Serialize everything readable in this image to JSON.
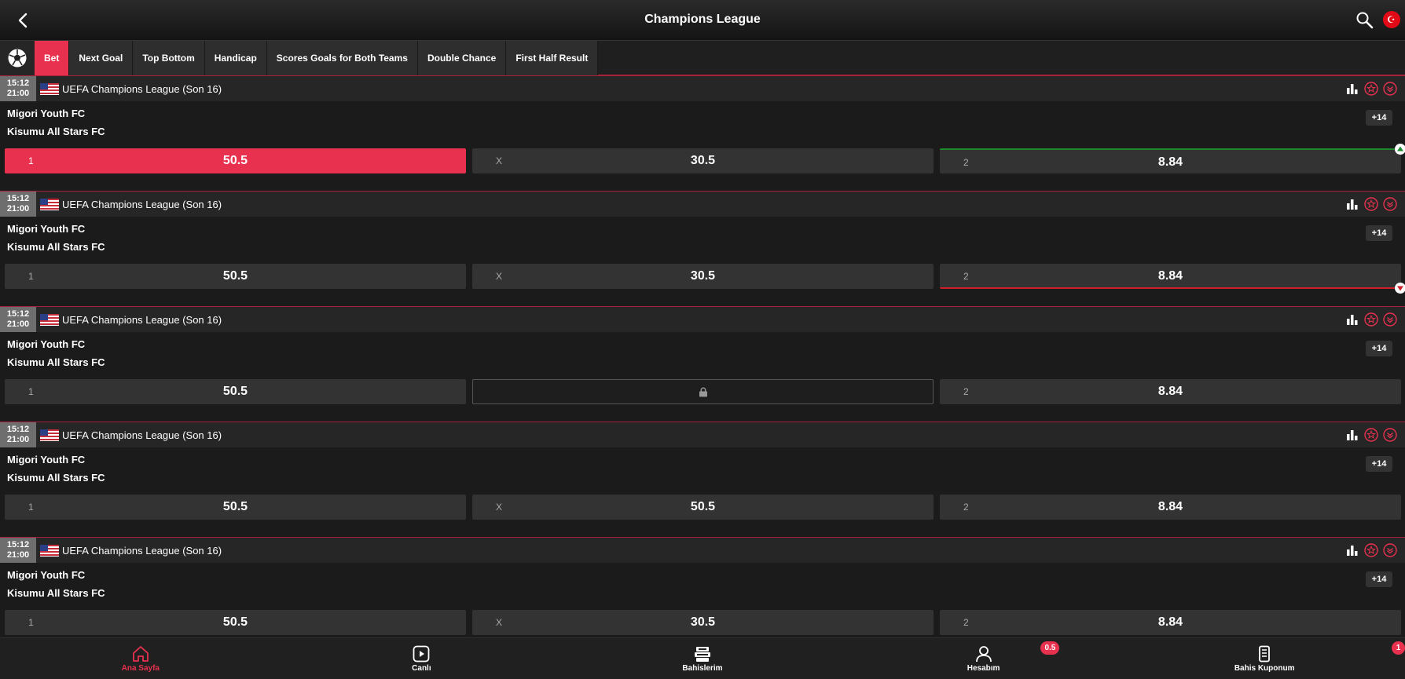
{
  "header": {
    "title": "Champions League"
  },
  "flag_symbol": "☪",
  "tabs": [
    {
      "label": "Bet",
      "active": true
    },
    {
      "label": "Next Goal"
    },
    {
      "label": "Top Bottom"
    },
    {
      "label": "Handicap"
    },
    {
      "label": "Scores Goals for Both Teams"
    },
    {
      "label": "Double Chance"
    },
    {
      "label": "First Half Result"
    }
  ],
  "events": [
    {
      "time": "15:12",
      "hour": "21:00",
      "league": "UEFA Champions League (Son 16)",
      "team1": "Migori Youth FC",
      "team2": "Kisumu All Stars FC",
      "more": "+14",
      "odds": [
        {
          "label": "1",
          "value": "50.5",
          "state": "selected"
        },
        {
          "label": "X",
          "value": "30.5"
        },
        {
          "label": "2",
          "value": "8.84",
          "trend": "up"
        }
      ]
    },
    {
      "time": "15:12",
      "hour": "21:00",
      "league": "UEFA Champions League (Son 16)",
      "team1": "Migori Youth FC",
      "team2": "Kisumu All Stars FC",
      "more": "+14",
      "odds": [
        {
          "label": "1",
          "value": "50.5"
        },
        {
          "label": "X",
          "value": "30.5"
        },
        {
          "label": "2",
          "value": "8.84",
          "trend": "down"
        }
      ]
    },
    {
      "time": "15:12",
      "hour": "21:00",
      "league": "UEFA Champions League (Son 16)",
      "team1": "Migori Youth FC",
      "team2": "Kisumu All Stars FC",
      "more": "+14",
      "odds": [
        {
          "label": "1",
          "value": "50.5"
        },
        {
          "label": "",
          "value": "",
          "state": "locked"
        },
        {
          "label": "2",
          "value": "8.84"
        }
      ]
    },
    {
      "time": "15:12",
      "hour": "21:00",
      "league": "UEFA Champions League (Son 16)",
      "team1": "Migori Youth FC",
      "team2": "Kisumu All Stars FC",
      "more": "+14",
      "odds": [
        {
          "label": "1",
          "value": "50.5"
        },
        {
          "label": "X",
          "value": "50.5"
        },
        {
          "label": "2",
          "value": "8.84"
        }
      ]
    },
    {
      "time": "15:12",
      "hour": "21:00",
      "league": "UEFA Champions League (Son 16)",
      "team1": "Migori Youth FC",
      "team2": "Kisumu All Stars FC",
      "more": "+14",
      "odds": [
        {
          "label": "1",
          "value": "50.5"
        },
        {
          "label": "X",
          "value": "30.5"
        },
        {
          "label": "2",
          "value": "8.84"
        }
      ]
    }
  ],
  "footer": [
    {
      "label": "Ana Sayfa",
      "icon": "home-icon",
      "active": true
    },
    {
      "label": "Canlı",
      "icon": "play-icon"
    },
    {
      "label": "Bahislerim",
      "icon": "bets-icon"
    },
    {
      "label": "Hesabım",
      "icon": "user-icon",
      "badge": "0.5"
    },
    {
      "label": "Bahis Kuponum",
      "icon": "coupon-icon",
      "badge": "1"
    }
  ],
  "colors": {
    "accent": "#e8314f",
    "up": "#1e8a2e",
    "down": "#d01f2a"
  }
}
